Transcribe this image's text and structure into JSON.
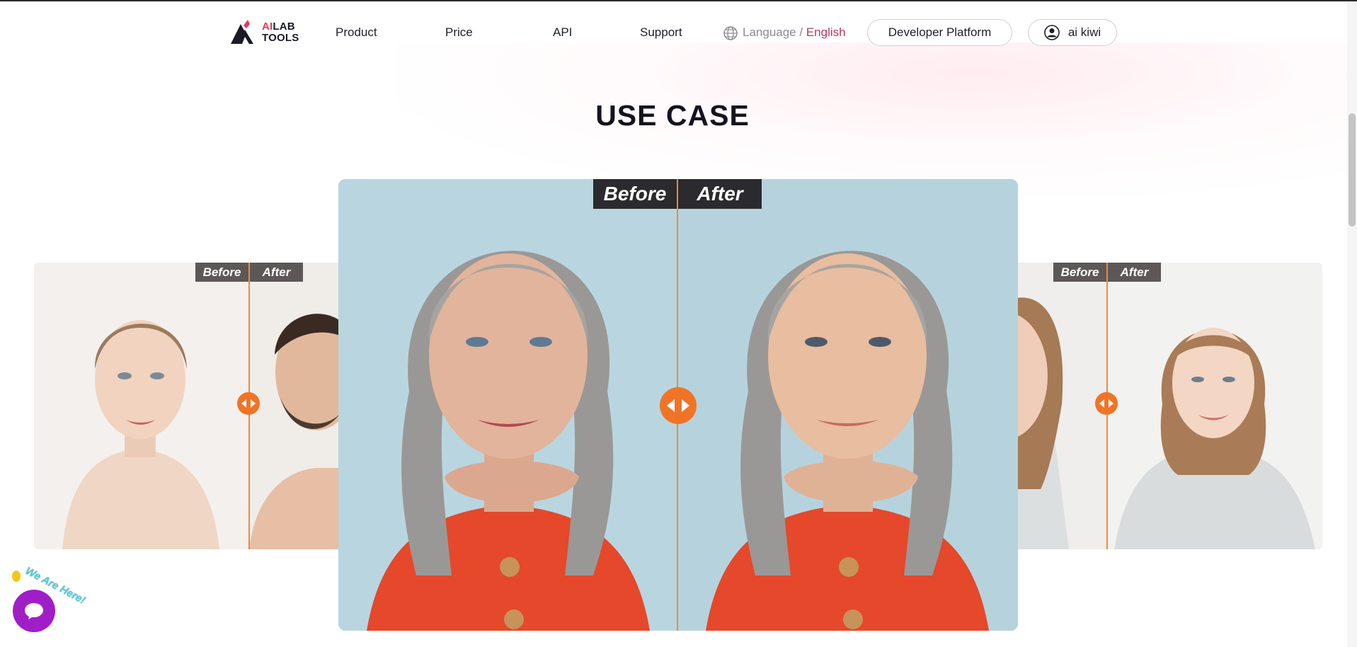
{
  "brand": {
    "ai": "AI",
    "lab": "LAB",
    "tools": "TOOLS"
  },
  "nav": {
    "items": [
      {
        "label": "Product"
      },
      {
        "label": "Price"
      },
      {
        "label": "API"
      },
      {
        "label": "Support"
      }
    ],
    "language_prefix": "Language /",
    "language_current": "English",
    "developer_button": "Developer Platform",
    "user_name": "ai kiwi"
  },
  "section": {
    "title": "USE CASE"
  },
  "comparison": {
    "before_label": "Before",
    "after_label": "After"
  },
  "chat": {
    "label": "We Are Here!"
  },
  "colors": {
    "accent": "#f07425",
    "brand": "#e8365d",
    "chat": "#a01ec8",
    "language_highlight": "#b23a63"
  },
  "icons": [
    "globe-icon",
    "user-avatar-icon",
    "slider-arrows-icon",
    "chat-bubble-icon",
    "waving-hand-icon"
  ]
}
